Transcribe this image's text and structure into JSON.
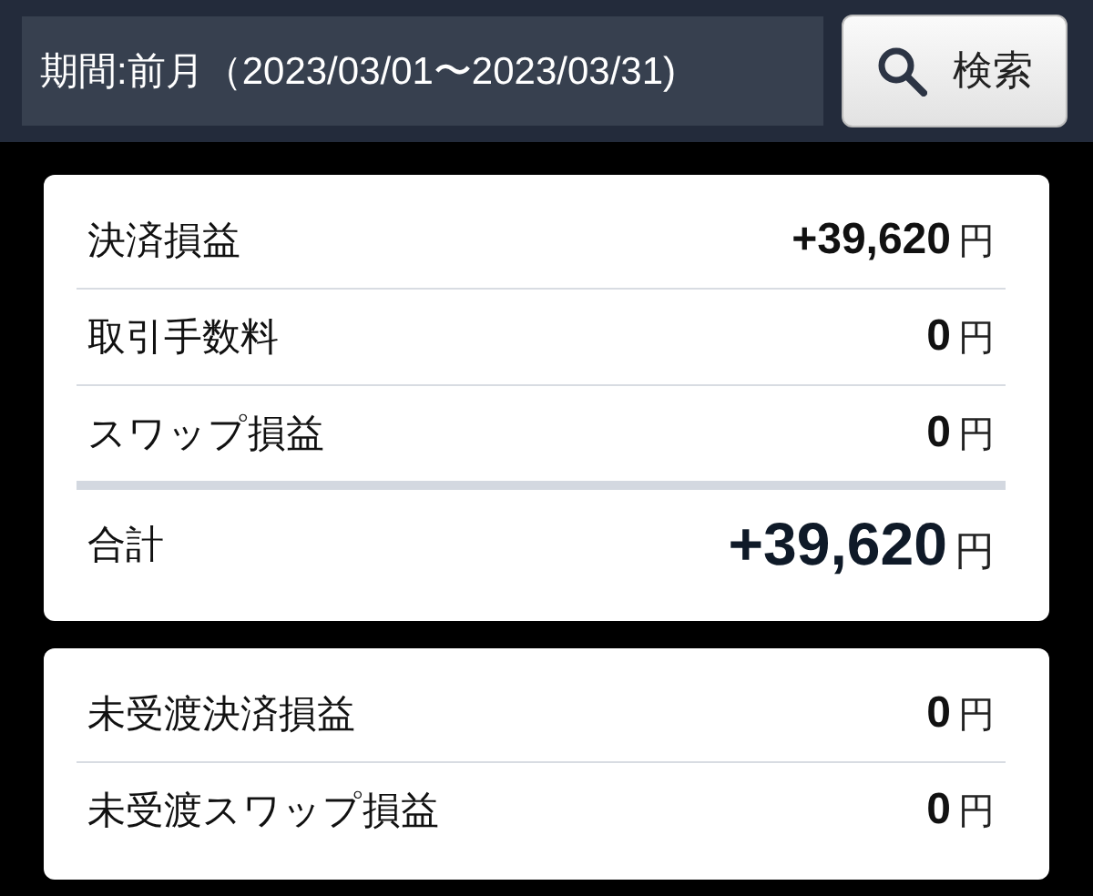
{
  "header": {
    "period": "期間:前月（2023/03/01〜2023/03/31)",
    "search_button": "検索"
  },
  "cards": [
    {
      "rows": [
        {
          "kind": "item",
          "label": "決済損益",
          "value": "+39,620",
          "unit": "円"
        },
        {
          "kind": "item",
          "label": "取引手数料",
          "value": "0",
          "unit": "円"
        },
        {
          "kind": "item",
          "label": "スワップ損益",
          "value": "0",
          "unit": "円"
        },
        {
          "kind": "total",
          "label": "合計",
          "value": "+39,620",
          "unit": "円"
        }
      ]
    },
    {
      "rows": [
        {
          "kind": "item",
          "label": "未受渡決済損益",
          "value": "0",
          "unit": "円"
        },
        {
          "kind": "item",
          "label": "未受渡スワップ損益",
          "value": "0",
          "unit": "円"
        }
      ]
    }
  ]
}
